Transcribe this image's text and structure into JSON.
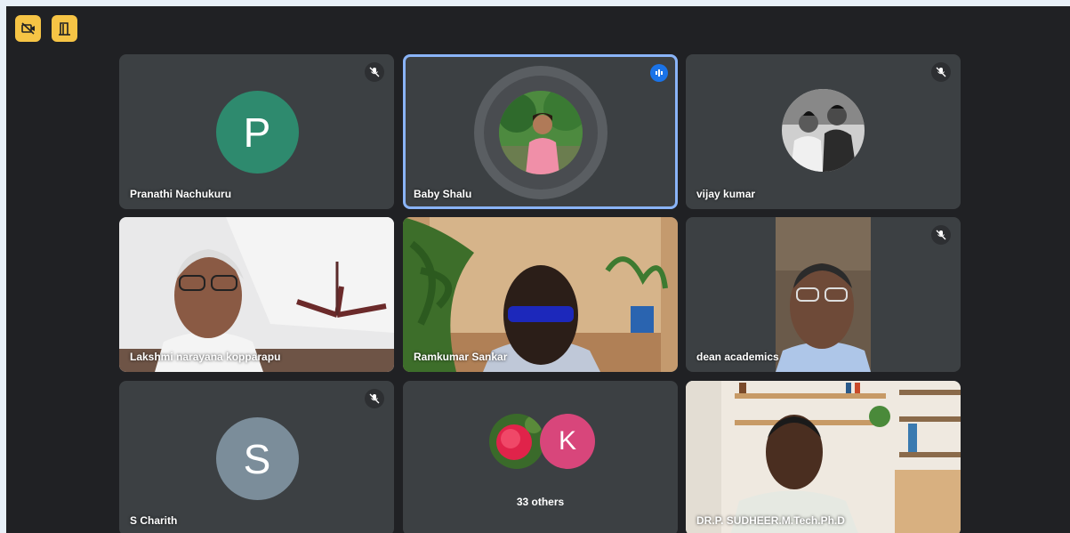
{
  "toolbar": {
    "buttons": [
      {
        "icon": "camera-off-icon"
      },
      {
        "icon": "leave-door-icon"
      }
    ],
    "accent": "#f6c445"
  },
  "participants": [
    {
      "name": "Pranathi Nachukuru",
      "initial": "P",
      "avatar_color": "#2e8a6e",
      "muted": true
    },
    {
      "name": "Baby Shalu",
      "muted": false,
      "speaking": true
    },
    {
      "name": "vijay kumar",
      "muted": true
    },
    {
      "name": "Lakshmi narayana kopparapu",
      "muted": false
    },
    {
      "name": "Ramkumar Sankar",
      "muted": false
    },
    {
      "name": "dean academics",
      "muted": true
    },
    {
      "name": "S Charith",
      "initial": "S",
      "avatar_color": "#7b8d9a",
      "muted": true
    },
    {
      "others_label": "33 others",
      "initial": "K",
      "avatar_color": "#d8467b"
    },
    {
      "name": "DR.P. SUDHEER.M.Tech.Ph.D",
      "muted": false
    }
  ],
  "colors": {
    "background": "#202124",
    "tile": "#3c4043",
    "speaking_border": "#8ab4f8"
  }
}
